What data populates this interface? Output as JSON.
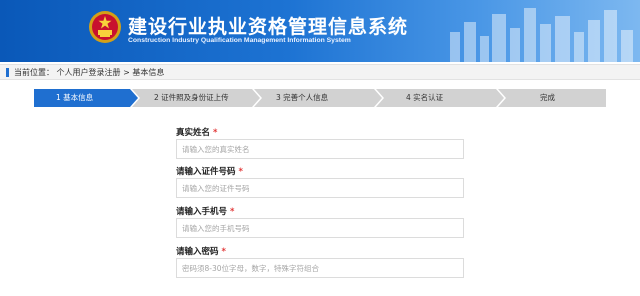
{
  "header": {
    "title_cn": "建设行业执业资格管理信息系统",
    "title_en": "Construction Industry Qualification Management Information System"
  },
  "breadcrumb": {
    "text": "当前位置： 个人用户登录注册 > 基本信息"
  },
  "steps": [
    {
      "label": "1 基本信息",
      "active": true
    },
    {
      "label": "2 证件照及身份证上传",
      "active": false
    },
    {
      "label": "3 完善个人信息",
      "active": false
    },
    {
      "label": "4 实名认证",
      "active": false
    },
    {
      "label": "完成",
      "active": false
    }
  ],
  "form": {
    "fields": [
      {
        "label": "真实姓名",
        "required_mark": "*",
        "placeholder": "请输入您的真实姓名"
      },
      {
        "label": "请输入证件号码",
        "required_mark": "*",
        "placeholder": "请输入您的证件号码"
      },
      {
        "label": "请输入手机号",
        "required_mark": "*",
        "placeholder": "请输入您的手机号码"
      },
      {
        "label": "请输入密码",
        "required_mark": "*",
        "placeholder": "密码须8-30位字母，数字，特殊字符组合"
      }
    ]
  },
  "colors": {
    "header_blue": "#1d73d3",
    "active_step": "#1f6fd0",
    "inactive_step": "#d2d2d2",
    "required": "#e23a3a"
  },
  "icons": {
    "emblem": "national-emblem-icon"
  }
}
